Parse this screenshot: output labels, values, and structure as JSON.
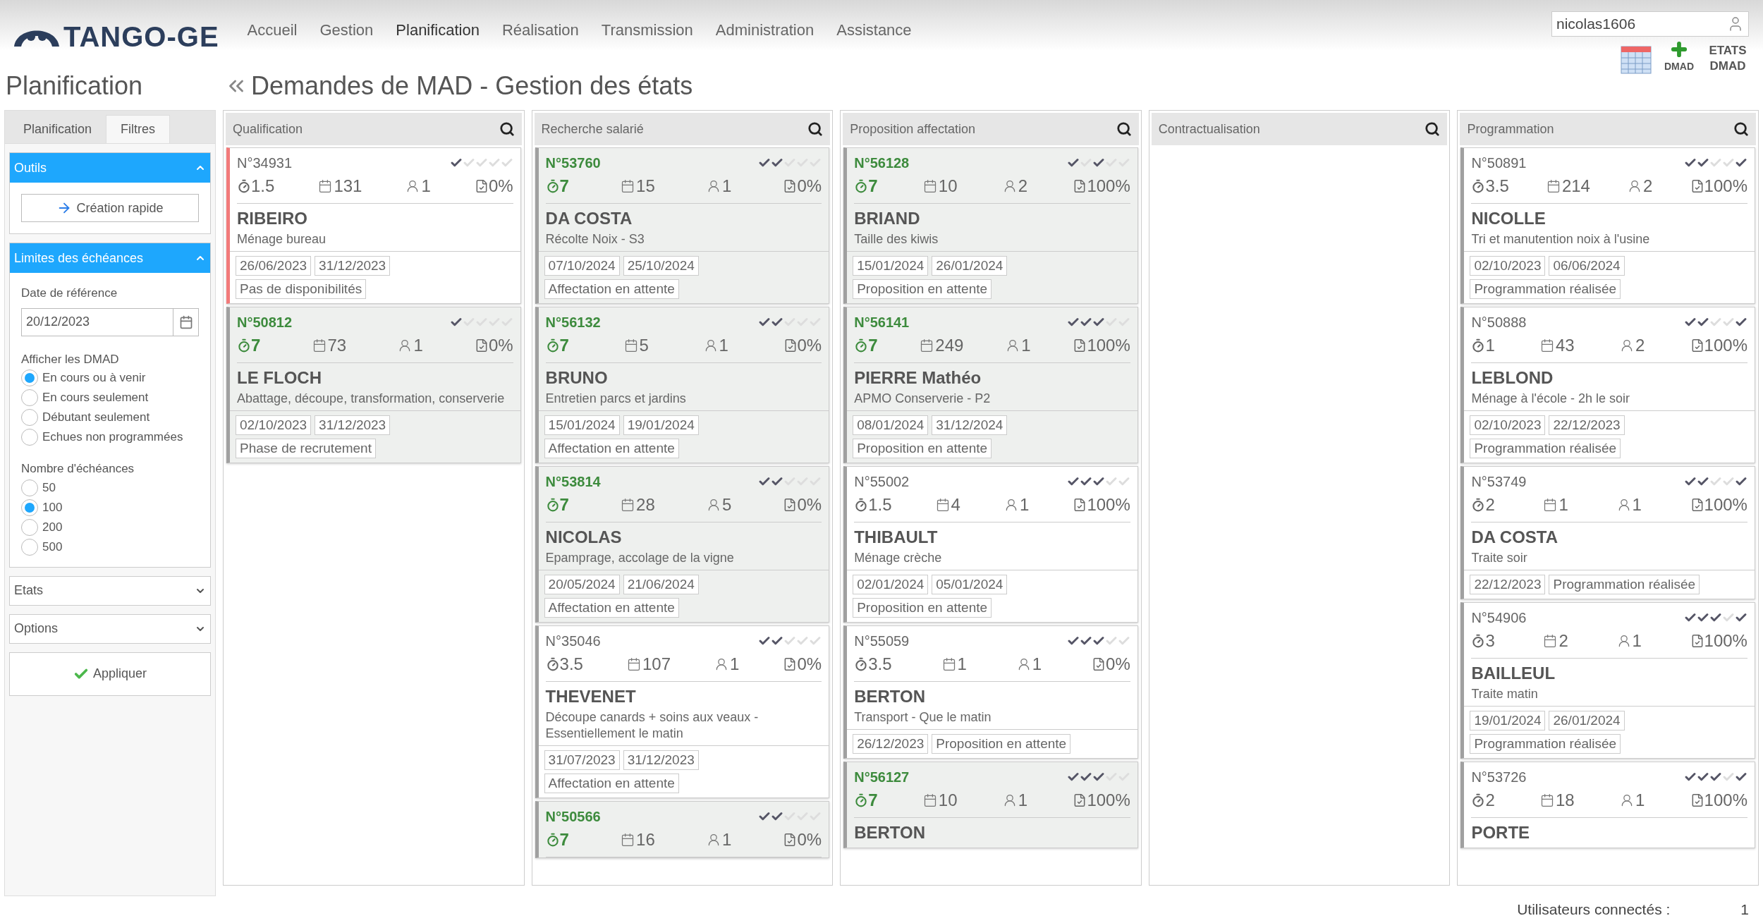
{
  "header": {
    "logo": "TANGO-GE",
    "nav": [
      {
        "label": "Accueil",
        "selected": false
      },
      {
        "label": "Gestion",
        "selected": false
      },
      {
        "label": "Planification",
        "selected": true
      },
      {
        "label": "Réalisation",
        "selected": false
      },
      {
        "label": "Transmission",
        "selected": false
      },
      {
        "label": "Administration",
        "selected": false
      },
      {
        "label": "Assistance",
        "selected": false
      }
    ],
    "user": "nicolas1606",
    "add_label": "DMAD",
    "states_label": "ETATS DMAD"
  },
  "page_title": "Planification",
  "board_title": "Demandes de MAD - Gestion des états",
  "sidebar": {
    "tabs": [
      {
        "label": "Planification",
        "selected": false
      },
      {
        "label": "Filtres",
        "selected": true
      }
    ],
    "tools": {
      "title": "Outils",
      "expanded": true,
      "button": "Création rapide"
    },
    "limits": {
      "title": "Limites des échéances",
      "expanded": true,
      "date_label": "Date de référence",
      "date_value": "20/12/2023",
      "display_label": "Afficher les DMAD",
      "display_options": [
        {
          "label": "En cours ou à venir",
          "selected": true
        },
        {
          "label": "En cours seulement",
          "selected": false
        },
        {
          "label": "Débutant seulement",
          "selected": false
        },
        {
          "label": "Echues non programmées",
          "selected": false
        }
      ],
      "count_label": "Nombre d'échéances",
      "count_options": [
        {
          "label": "50",
          "selected": false
        },
        {
          "label": "100",
          "selected": true
        },
        {
          "label": "200",
          "selected": false
        },
        {
          "label": "500",
          "selected": false
        }
      ]
    },
    "panels": [
      {
        "title": "Etats",
        "expanded": false
      },
      {
        "title": "Options",
        "expanded": false
      }
    ],
    "apply": "Appliquer"
  },
  "columns": [
    {
      "title": "Qualification",
      "cards": [
        {
          "number": "N°34931",
          "highlighted": false,
          "alert": true,
          "checks": [
            true,
            false,
            false,
            false,
            false
          ],
          "duration": "1.5",
          "days": "131",
          "people": "1",
          "progress": "0%",
          "name": "RIBEIRO",
          "description": "Ménage bureau",
          "dates": [
            "26/06/2023",
            "31/12/2023"
          ],
          "status": "Pas de disponibilités"
        },
        {
          "number": "N°50812",
          "highlighted": true,
          "alert": false,
          "checks": [
            true,
            false,
            false,
            false,
            false
          ],
          "duration": "7",
          "days": "73",
          "people": "1",
          "progress": "0%",
          "name": "LE FLOCH",
          "description": "Abattage, découpe, transformation, conserverie",
          "dates": [
            "02/10/2023",
            "31/12/2023"
          ],
          "status": "Phase de recrutement"
        }
      ]
    },
    {
      "title": "Recherche salarié",
      "cards": [
        {
          "number": "N°53760",
          "highlighted": true,
          "alert": false,
          "checks": [
            true,
            true,
            false,
            false,
            false
          ],
          "duration": "7",
          "days": "15",
          "people": "1",
          "progress": "0%",
          "name": "DA COSTA",
          "description": "Récolte Noix - S3",
          "dates": [
            "07/10/2024",
            "25/10/2024"
          ],
          "status": "Affectation en attente"
        },
        {
          "number": "N°56132",
          "highlighted": true,
          "alert": false,
          "checks": [
            true,
            true,
            false,
            false,
            false
          ],
          "duration": "7",
          "days": "5",
          "people": "1",
          "progress": "0%",
          "name": "BRUNO",
          "description": "Entretien parcs et jardins",
          "dates": [
            "15/01/2024",
            "19/01/2024"
          ],
          "status": "Affectation en attente"
        },
        {
          "number": "N°53814",
          "highlighted": true,
          "alert": false,
          "checks": [
            true,
            true,
            false,
            false,
            false
          ],
          "duration": "7",
          "days": "28",
          "people": "5",
          "progress": "0%",
          "name": "NICOLAS",
          "description": "Epamprage, accolage de la vigne",
          "dates": [
            "20/05/2024",
            "21/06/2024"
          ],
          "status": "Affectation en attente"
        },
        {
          "number": "N°35046",
          "highlighted": false,
          "alert": false,
          "checks": [
            true,
            true,
            false,
            false,
            false
          ],
          "duration": "3.5",
          "days": "107",
          "people": "1",
          "progress": "0%",
          "name": "THEVENET",
          "description": "Découpe canards + soins aux veaux - Essentiellement le matin",
          "dates": [
            "31/07/2023",
            "31/12/2023"
          ],
          "status": "Affectation en attente"
        },
        {
          "number": "N°50566",
          "highlighted": true,
          "alert": false,
          "checks": [
            true,
            true,
            false,
            false,
            false
          ],
          "duration": "7",
          "days": "16",
          "people": "1",
          "progress": "0%"
        }
      ]
    },
    {
      "title": "Proposition affectation",
      "cards": [
        {
          "number": "N°56128",
          "highlighted": true,
          "alert": false,
          "checks": [
            true,
            false,
            true,
            false,
            false
          ],
          "duration": "7",
          "days": "10",
          "people": "2",
          "progress": "100%",
          "name": "BRIAND",
          "description": "Taille des kiwis",
          "dates": [
            "15/01/2024",
            "26/01/2024"
          ],
          "status": "Proposition en attente"
        },
        {
          "number": "N°56141",
          "highlighted": true,
          "alert": false,
          "checks": [
            true,
            true,
            true,
            false,
            false
          ],
          "duration": "7",
          "days": "249",
          "people": "1",
          "progress": "100%",
          "name": "PIERRE Mathéo",
          "description": "APMO Conserverie - P2",
          "dates": [
            "08/01/2024",
            "31/12/2024"
          ],
          "status": "Proposition en attente"
        },
        {
          "number": "N°55002",
          "highlighted": false,
          "alert": false,
          "checks": [
            true,
            true,
            true,
            false,
            false
          ],
          "duration": "1.5",
          "days": "4",
          "people": "1",
          "progress": "100%",
          "name": "THIBAULT",
          "description": "Ménage crèche",
          "dates": [
            "02/01/2024",
            "05/01/2024"
          ],
          "status": "Proposition en attente"
        },
        {
          "number": "N°55059",
          "highlighted": false,
          "alert": false,
          "checks": [
            true,
            true,
            true,
            false,
            false
          ],
          "duration": "3.5",
          "days": "1",
          "people": "1",
          "progress": "0%",
          "name": "BERTON",
          "description": "Transport - Que le matin",
          "dates": [
            "26/12/2023"
          ],
          "status": "Proposition en attente"
        },
        {
          "number": "N°56127",
          "highlighted": true,
          "alert": false,
          "checks": [
            true,
            true,
            true,
            false,
            false
          ],
          "duration": "7",
          "days": "10",
          "people": "1",
          "progress": "100%",
          "name": "BERTON"
        }
      ]
    },
    {
      "title": "Contractualisation"
    },
    {
      "title": "Programmation",
      "cards": [
        {
          "number": "N°50891",
          "highlighted": false,
          "alert": false,
          "checks": [
            true,
            true,
            false,
            false,
            true
          ],
          "duration": "3.5",
          "days": "214",
          "people": "2",
          "progress": "100%",
          "name": "NICOLLE",
          "description": "Tri et manutention noix à l'usine",
          "dates": [
            "02/10/2023",
            "06/06/2024"
          ],
          "status": "Programmation réalisée"
        },
        {
          "number": "N°50888",
          "highlighted": false,
          "alert": false,
          "checks": [
            true,
            true,
            false,
            false,
            true
          ],
          "duration": "1",
          "days": "43",
          "people": "2",
          "progress": "100%",
          "name": "LEBLOND",
          "description": "Ménage à l'école - 2h le soir",
          "dates": [
            "02/10/2023",
            "22/12/2023"
          ],
          "status": "Programmation réalisée"
        },
        {
          "number": "N°53749",
          "highlighted": false,
          "alert": false,
          "checks": [
            true,
            true,
            false,
            false,
            true
          ],
          "duration": "2",
          "days": "1",
          "people": "1",
          "progress": "100%",
          "name": "DA COSTA",
          "description": "Traite soir",
          "dates": [
            "22/12/2023"
          ],
          "status": "Programmation réalisée"
        },
        {
          "number": "N°54906",
          "highlighted": false,
          "alert": false,
          "checks": [
            true,
            true,
            true,
            false,
            true
          ],
          "duration": "3",
          "days": "2",
          "people": "1",
          "progress": "100%",
          "name": "BAILLEUL",
          "description": "Traite matin",
          "dates": [
            "19/01/2024",
            "26/01/2024"
          ],
          "status": "Programmation réalisée"
        },
        {
          "number": "N°53726",
          "highlighted": false,
          "alert": false,
          "checks": [
            true,
            true,
            true,
            false,
            true
          ],
          "duration": "2",
          "days": "18",
          "people": "1",
          "progress": "100%",
          "name": "PORTE"
        }
      ]
    }
  ],
  "footer": {
    "label": "Utilisateurs connectés :",
    "count": "1"
  }
}
